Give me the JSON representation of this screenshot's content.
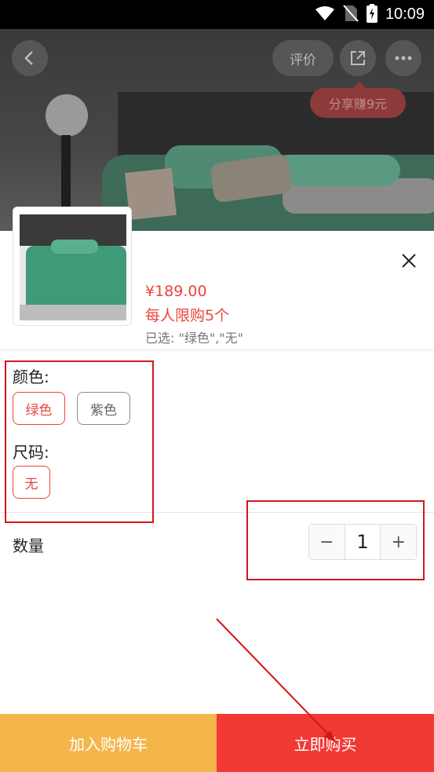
{
  "status_bar": {
    "time": "10:09"
  },
  "header": {
    "review_label": "评价",
    "share_tip": "分享赚9元"
  },
  "product": {
    "price": "¥189.00",
    "limit": "每人限购5个",
    "selected": "已选: \"绿色\",\"无\""
  },
  "color": {
    "label": "颜色:",
    "options": [
      {
        "label": "绿色",
        "selected": true
      },
      {
        "label": "紫色",
        "selected": false
      }
    ]
  },
  "size": {
    "label": "尺码:",
    "options": [
      {
        "label": "无",
        "selected": true
      }
    ]
  },
  "quantity": {
    "label": "数量",
    "value": "1",
    "minus": "−",
    "plus": "+"
  },
  "actions": {
    "add_to_cart": "加入购物车",
    "buy_now": "立即购买"
  },
  "colors": {
    "accent": "#e8463c",
    "cart": "#f4b54a",
    "buy": "#f23a35",
    "annotation": "#d4151b"
  }
}
